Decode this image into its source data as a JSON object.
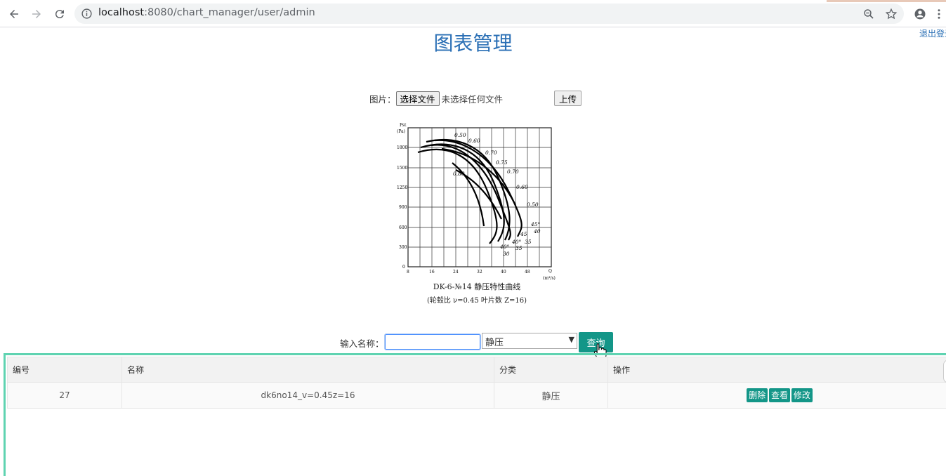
{
  "browser": {
    "url_host": "localhost",
    "url_rest": ":8080/chart_manager/user/admin",
    "icons": [
      "back-arrow-icon",
      "forward-arrow-icon",
      "reload-icon",
      "info-icon",
      "zoom-icon",
      "star-icon",
      "account-icon",
      "menu-dots-icon"
    ]
  },
  "header": {
    "title": "图表管理",
    "logout": "退出登录"
  },
  "upload": {
    "label": "图片：",
    "choose_button": "选择文件",
    "no_file": "未选择任何文件",
    "upload_button": "上传"
  },
  "chart_image": {
    "y_axis_label": "Pst",
    "y_axis_unit": "(Pa)",
    "x_axis_label": "Q",
    "x_axis_unit": "(m³/s)",
    "y_ticks": [
      "0",
      "300",
      "600",
      "900",
      "1250",
      "1500",
      "1800"
    ],
    "x_ticks": [
      "8",
      "16",
      "24",
      "32",
      "40",
      "48"
    ],
    "curve_labels": [
      "0.50",
      "0.60",
      "0.70",
      "0.75",
      "0.70",
      "0.60",
      "0.50",
      "0.80"
    ],
    "angle_labels": [
      "45°",
      "40",
      "35",
      "45",
      "40°",
      "35",
      "40°",
      "30"
    ],
    "caption_line1": "DK-6-№14  静压特性曲线",
    "caption_line2": "(轮毂比 ν=0.45 叶片数 Z=16)"
  },
  "search": {
    "label": "输入名称：",
    "input_value": "",
    "category_selected": "静压",
    "query_button": "查询"
  },
  "table": {
    "headers": [
      "编号",
      "名称",
      "分类",
      "操作"
    ],
    "rows": [
      {
        "id": "27",
        "name": "dk6no14_v=0.45z=16",
        "category": "静压"
      }
    ],
    "actions": [
      "删除",
      "查看",
      "修改"
    ]
  }
}
